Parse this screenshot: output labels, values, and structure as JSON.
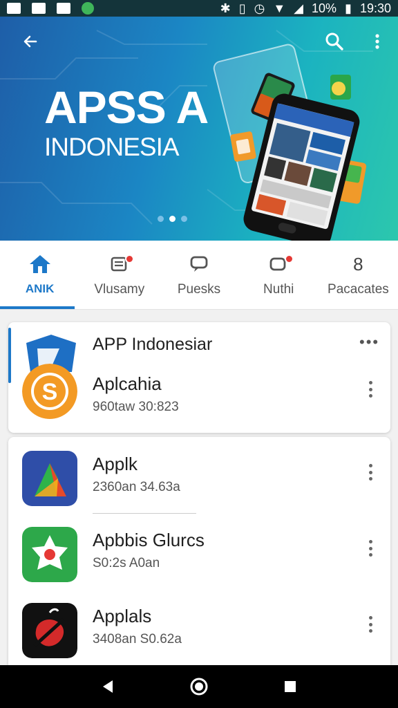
{
  "status_bar": {
    "battery": "10%",
    "time": "19:30"
  },
  "hero": {
    "title": "APSS A",
    "subtitle": "INDONESIA",
    "carousel_total": 3,
    "carousel_active": 2
  },
  "tabs": [
    {
      "label": "ANIK",
      "icon": "home-icon",
      "active": true
    },
    {
      "label": "Vlusamy",
      "icon": "document-icon",
      "badge": true
    },
    {
      "label": "Puesks",
      "icon": "chat-icon"
    },
    {
      "label": "Nuthi",
      "icon": "message-icon",
      "badge": true
    },
    {
      "label": "Pacacates",
      "icon": "number-icon",
      "icon_text": "8"
    }
  ],
  "section": {
    "title": "APP Indonesiar",
    "more": "•••"
  },
  "apps": [
    {
      "name": "Aplcahia",
      "meta": "960taw 30:823",
      "icon": "s-logo-icon"
    },
    {
      "name": "Applk",
      "meta": "2360an 34.63a",
      "icon": "arrow-logo-icon"
    },
    {
      "name": "Apbbis Glurcs",
      "meta": "S0:2s A0an",
      "icon": "star-logo-icon"
    },
    {
      "name": "Applals",
      "meta": "3408an S0.62a",
      "icon": "pepper-logo-icon"
    }
  ],
  "colors": {
    "accent": "#1d78c8",
    "hero_start": "#1e5ea8",
    "hero_end": "#2cc7ad",
    "badge": "#e53935"
  }
}
